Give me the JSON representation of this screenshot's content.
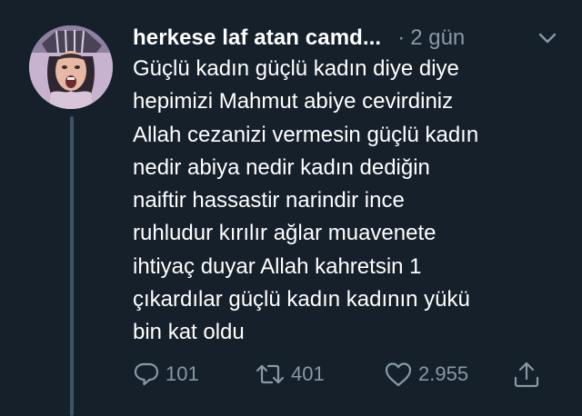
{
  "tweet": {
    "display_name": "herkese laf atan camd...",
    "separator": "·",
    "time": "2 gün",
    "lines": [
      "Güçlü kadın güçlü kadın diye diye",
      "hepimizi Mahmut abiye cevirdiniz",
      "Allah cezanizi vermesin güçlü kadın",
      "nedir abiya nedir kadın dediğin",
      "naiftir hassastir narindir ince",
      "ruhludur kırılır ağlar muavenete",
      "ihtiyaç duyar Allah kahretsin 1",
      "çıkardılar güçlü kadın kadının yükü",
      "bin kat oldu"
    ]
  },
  "actions": {
    "replies": "101",
    "retweets": "401",
    "likes": "2.955"
  },
  "icons": {
    "avatar": "avatar",
    "more": "chevron-down-icon",
    "reply": "reply-icon",
    "retweet": "retweet-icon",
    "like": "heart-icon",
    "share": "share-icon"
  },
  "colors": {
    "background": "#15202b",
    "text": "#ffffff",
    "muted": "#8899a6",
    "thread_line": "#3d5466"
  }
}
